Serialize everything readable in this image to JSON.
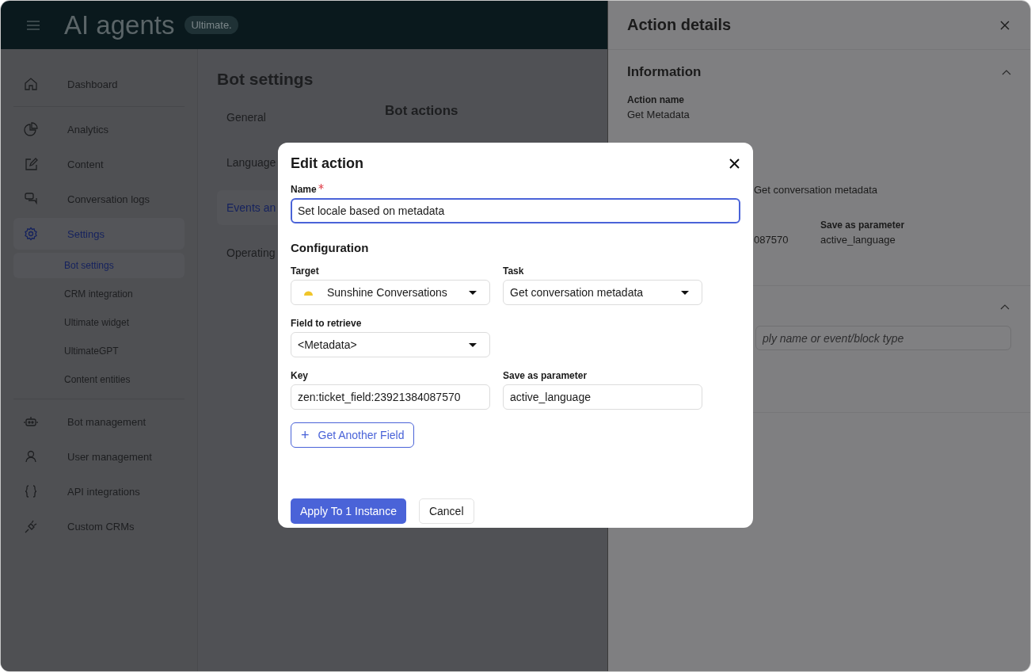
{
  "header": {
    "title": "AI agents",
    "badge": "Ultimate."
  },
  "sidebar": {
    "sections": [
      {
        "items": [
          {
            "label": "Dashboard",
            "kind": "home",
            "selected": false
          }
        ]
      },
      {
        "items": [
          {
            "label": "Analytics",
            "kind": "pie",
            "selected": false
          },
          {
            "label": "Content",
            "kind": "edit",
            "selected": false
          },
          {
            "label": "Conversation logs",
            "kind": "chat",
            "selected": false
          },
          {
            "label": "Settings",
            "kind": "gear",
            "selected": true,
            "children": [
              {
                "label": "Bot settings",
                "selected": true
              },
              {
                "label": "CRM integration",
                "selected": false
              },
              {
                "label": "Ultimate widget",
                "selected": false
              },
              {
                "label": "UltimateGPT",
                "selected": false
              },
              {
                "label": "Content entities",
                "selected": false
              }
            ]
          }
        ]
      },
      {
        "items": [
          {
            "label": "Bot management",
            "kind": "robot",
            "selected": false
          },
          {
            "label": "User management",
            "kind": "user",
            "selected": false
          },
          {
            "label": "API integrations",
            "kind": "braces",
            "selected": false
          },
          {
            "label": "Custom CRMs",
            "kind": "plug",
            "selected": false
          }
        ]
      }
    ]
  },
  "main": {
    "title": "Bot settings",
    "nav": [
      {
        "label": "General",
        "selected": false
      },
      {
        "label": "Language",
        "selected": false
      },
      {
        "label": "Events an",
        "selected": true
      },
      {
        "label": "Operating",
        "selected": false
      }
    ],
    "section_title": "Bot actions"
  },
  "details_panel": {
    "title": "Action details",
    "information": {
      "title": "Information",
      "expanded": true,
      "action_name_label": "Action name",
      "action_name": "Get Metadata",
      "task": "Get conversation metadata",
      "key_value": "087570",
      "save_label": "Save as parameter",
      "save_value": "active_language"
    },
    "second_section": {
      "expanded": true,
      "search": {
        "placeholder": "ply name or event/block type"
      }
    }
  },
  "modal": {
    "title": "Edit action",
    "name_label": "Name",
    "required": true,
    "name_value": "Set locale based on metadata",
    "configuration_title": "Configuration",
    "target": {
      "label": "Target",
      "value": "Sunshine Conversations"
    },
    "task": {
      "label": "Task",
      "value": "Get conversation metadata"
    },
    "field": {
      "label": "Field to retrieve",
      "value": "<Metadata>"
    },
    "key": {
      "label": "Key",
      "value": "zen:ticket_field:23921384087570"
    },
    "save": {
      "label": "Save as parameter",
      "value": "active_language"
    },
    "add_button": "Get Another Field",
    "add_icon": "+",
    "apply_button": "Apply To 1 Instance",
    "cancel_button": "Cancel"
  }
}
